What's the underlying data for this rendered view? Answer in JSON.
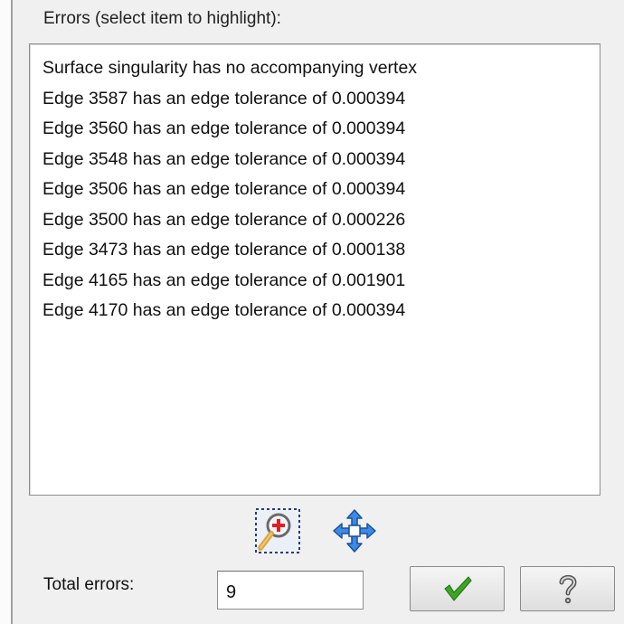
{
  "header": {
    "label": "Errors (select item to highlight):"
  },
  "errors": [
    "Surface singularity has no accompanying vertex",
    "Edge 3587 has an edge tolerance of 0.000394",
    "Edge 3560 has an edge tolerance of 0.000394",
    "Edge 3548 has an edge tolerance of 0.000394",
    "Edge 3506 has an edge tolerance of 0.000394",
    "Edge 3500 has an edge tolerance of 0.000226",
    "Edge 3473 has an edge tolerance of 0.000138",
    "Edge 4165 has an edge tolerance of 0.001901",
    "Edge 4170 has an edge tolerance of 0.000394"
  ],
  "toolbar": {
    "zoom_icon": "zoom-to-selection-icon",
    "pan_icon": "pan-move-icon"
  },
  "footer": {
    "total_label": "Total errors:",
    "total_value": "9",
    "ok_icon": "green-checkmark-icon",
    "help_icon": "question-mark-icon"
  },
  "colors": {
    "ok_check": "#2e9a1e",
    "zoom_plus": "#e02020",
    "pan_arrows": "#2f7de0"
  }
}
